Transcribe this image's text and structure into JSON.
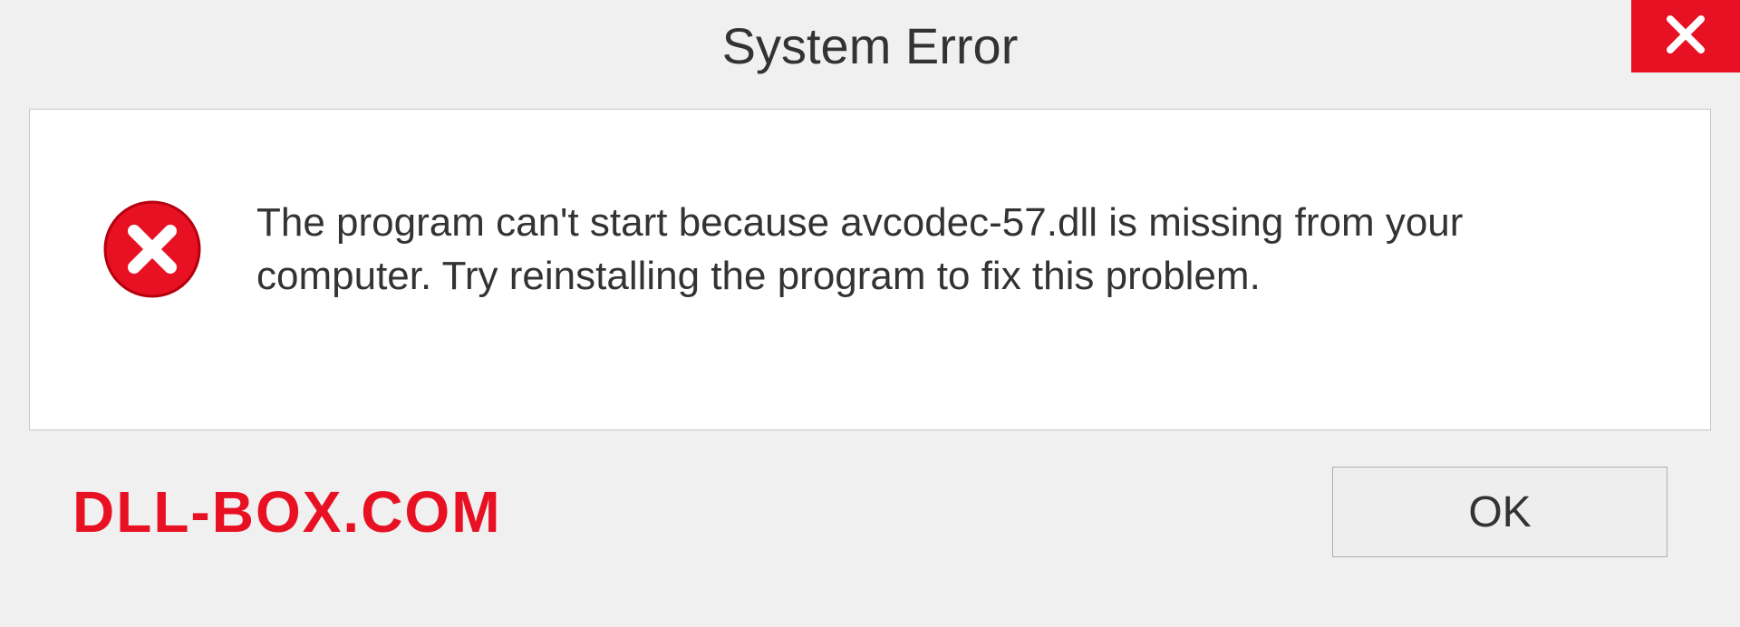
{
  "dialog": {
    "title": "System Error",
    "message": "The program can't start because avcodec-57.dll is missing from your computer. Try reinstalling the program to fix this problem.",
    "ok_label": "OK"
  },
  "watermark": "DLL-BOX.COM",
  "colors": {
    "accent_red": "#e81123"
  }
}
